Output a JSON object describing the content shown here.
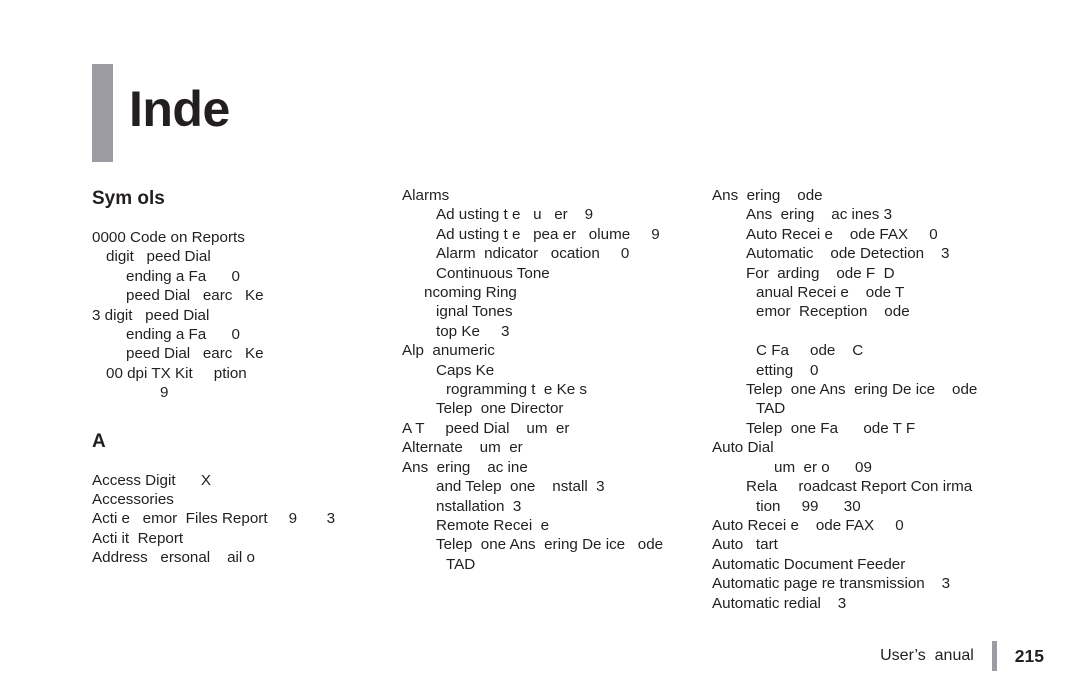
{
  "document": {
    "title": "Inde",
    "accent_color": "#9b9ba1",
    "text_color": "#231f20",
    "background_color": "#ffffff"
  },
  "footer": {
    "label": "User’s  anual",
    "page_number": "215"
  },
  "columns": [
    {
      "id": "column-1",
      "blocks": [
        {
          "heading": "Sym  ols",
          "entries": [
            {
              "text": "0000 Code on Reports",
              "level": 0
            },
            {
              "text": "digit   peed Dial",
              "level": 1
            },
            {
              "text": "ending a Fa      0",
              "level": 3
            },
            {
              "text": "peed Dial   earc   Ke",
              "level": 3
            },
            {
              "text": "3 digit   peed Dial",
              "level": 0
            },
            {
              "text": "ending a Fa      0",
              "level": 3
            },
            {
              "text": "peed Dial   earc   Ke",
              "level": 3
            },
            {
              "text": "00 dpi TX Kit     ption",
              "level": 1
            },
            {
              "text": "9",
              "level": 6
            }
          ]
        },
        {
          "heading": "A",
          "entries": [
            {
              "text": "Access Digit      X",
              "level": 0
            },
            {
              "text": "Accessories",
              "level": 0
            },
            {
              "text": "Acti e   emor  Files Report     9       3",
              "level": 0
            },
            {
              "text": "Acti it  Report",
              "level": 0
            },
            {
              "text": "Address   ersonal    ail o",
              "level": 0
            }
          ]
        }
      ]
    },
    {
      "id": "column-2",
      "blocks": [
        {
          "heading": "",
          "entries": [
            {
              "text": "Alarms",
              "level": 0
            },
            {
              "text": "Ad usting t e   u   er    9",
              "level": 3
            },
            {
              "text": "Ad usting t e   pea er   olume     9",
              "level": 3
            },
            {
              "text": "Alarm  ndicator   ocation     0",
              "level": 3
            },
            {
              "text": "Continuous Tone",
              "level": 3
            },
            {
              "text": "ncoming Ring",
              "level": 2
            },
            {
              "text": "ignal Tones",
              "level": 3
            },
            {
              "text": "top Ke     3",
              "level": 3
            },
            {
              "text": "Alp  anumeric",
              "level": 0
            },
            {
              "text": "Caps Ke",
              "level": 3
            },
            {
              "text": "rogramming t  e Ke s",
              "level": 4
            },
            {
              "text": "Telep  one Director",
              "level": 3
            },
            {
              "text": "A T     peed Dial    um  er",
              "level": 0
            },
            {
              "text": "Alternate    um  er",
              "level": 0
            },
            {
              "text": "Ans  ering    ac ine",
              "level": 0
            },
            {
              "text": "and Telep  one    nstall  3",
              "level": 3
            },
            {
              "text": "nstallation  3",
              "level": 3
            },
            {
              "text": "Remote Recei  e",
              "level": 3
            },
            {
              "text": "Telep  one Ans  ering De ice   ode",
              "level": 3
            },
            {
              "text": "TAD",
              "level": 4
            }
          ]
        }
      ]
    },
    {
      "id": "column-3",
      "blocks": [
        {
          "heading": "",
          "entries": [
            {
              "text": "Ans  ering    ode",
              "level": 0
            },
            {
              "text": "Ans  ering    ac ines 3",
              "level": 3
            },
            {
              "text": "Auto Recei e    ode FAX     0",
              "level": 3
            },
            {
              "text": "Automatic    ode Detection    3",
              "level": 3
            },
            {
              "text": "For  arding    ode F  D",
              "level": 3
            },
            {
              "text": "anual Recei e    ode T",
              "level": 4
            },
            {
              "text": "emor  Reception    ode",
              "level": 4
            },
            {
              "text": "",
              "level": 0
            },
            {
              "text": "C Fa     ode    C",
              "level": 4
            },
            {
              "text": "etting    0",
              "level": 4
            },
            {
              "text": "Telep  one Ans  ering De ice    ode",
              "level": 3
            },
            {
              "text": "TAD",
              "level": 4
            },
            {
              "text": "Telep  one Fa      ode T F",
              "level": 3
            },
            {
              "text": "Auto Dial",
              "level": 0
            },
            {
              "text": "um  er o      09",
              "level": 5
            },
            {
              "text": "Rela     roadcast Report Con irma",
              "level": 3
            },
            {
              "text": "tion     99      30",
              "level": 4
            },
            {
              "text": "Auto Recei e    ode FAX     0",
              "level": 0
            },
            {
              "text": "Auto   tart",
              "level": 0
            },
            {
              "text": "Automatic Document Feeder",
              "level": 0
            },
            {
              "text": "Automatic page re transmission    3",
              "level": 0
            },
            {
              "text": "Automatic redial    3",
              "level": 0
            }
          ]
        }
      ]
    }
  ]
}
